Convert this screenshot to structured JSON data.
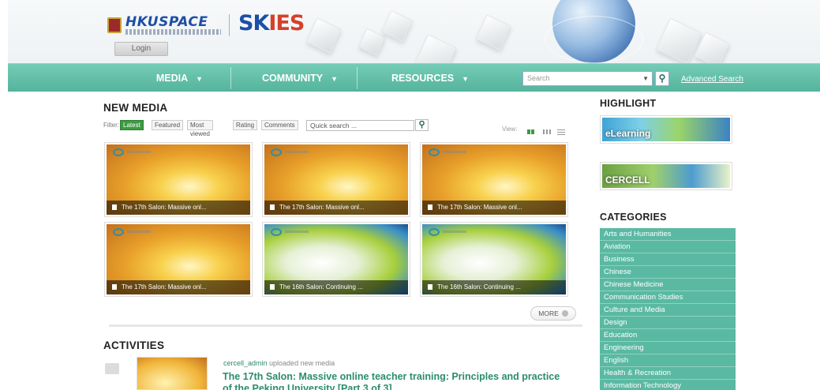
{
  "header": {
    "logo_primary": "HKUSPACE",
    "logo_secondary_main": "SK",
    "logo_secondary_accent": "IES",
    "login_label": "Login"
  },
  "nav": {
    "items": [
      {
        "label": "MEDIA"
      },
      {
        "label": "COMMUNITY"
      },
      {
        "label": "RESOURCES"
      }
    ],
    "search_placeholder": "Search",
    "search_icon": "search-icon",
    "advanced_search_label": "Advanced Search"
  },
  "new_media": {
    "title": "NEW MEDIA",
    "filter_label": "Filter:",
    "filters": [
      "Latest",
      "Featured",
      "Most viewed",
      "Rating",
      "Comments"
    ],
    "quick_search_placeholder": "Quick search ...",
    "view_label": "View:",
    "items": [
      {
        "caption": "The 17th Salon: Massive onl...",
        "style": "gold"
      },
      {
        "caption": "The 17th Salon: Massive onl...",
        "style": "gold"
      },
      {
        "caption": "The 17th Salon: Massive onl...",
        "style": "gold"
      },
      {
        "caption": "The 17th Salon: Massive onl...",
        "style": "gold"
      },
      {
        "caption": "The 16th Salon: Continuing ...",
        "style": "globe"
      },
      {
        "caption": "The 16th Salon: Continuing ...",
        "style": "globe"
      }
    ],
    "more_label": "MORE"
  },
  "activities": {
    "title": "ACTIVITIES",
    "entry": {
      "user": "cercell_admin",
      "action": " uploaded new media",
      "title": "The 17th Salon: Massive online teacher training: Principles and practice of the Peking University [Part 3 of 3]"
    }
  },
  "sidebar": {
    "highlight_title": "HIGHLIGHT",
    "highlights": [
      {
        "label": "eLearning"
      },
      {
        "label": "CERCELL"
      }
    ],
    "categories_title": "CATEGORIES",
    "categories": [
      "Arts and Humanities",
      "Aviation",
      "Business",
      "Chinese",
      "Chinese Medicine",
      "Communication Studies",
      "Culture and Media",
      "Design",
      "Education",
      "Engineering",
      "English",
      "Health & Recreation",
      "Information Technology"
    ]
  },
  "colors": {
    "nav_teal": "#5dbda6",
    "category_teal": "#5ab9a3",
    "link_green": "#2a8c6e",
    "active_filter": "#3d9a43"
  }
}
